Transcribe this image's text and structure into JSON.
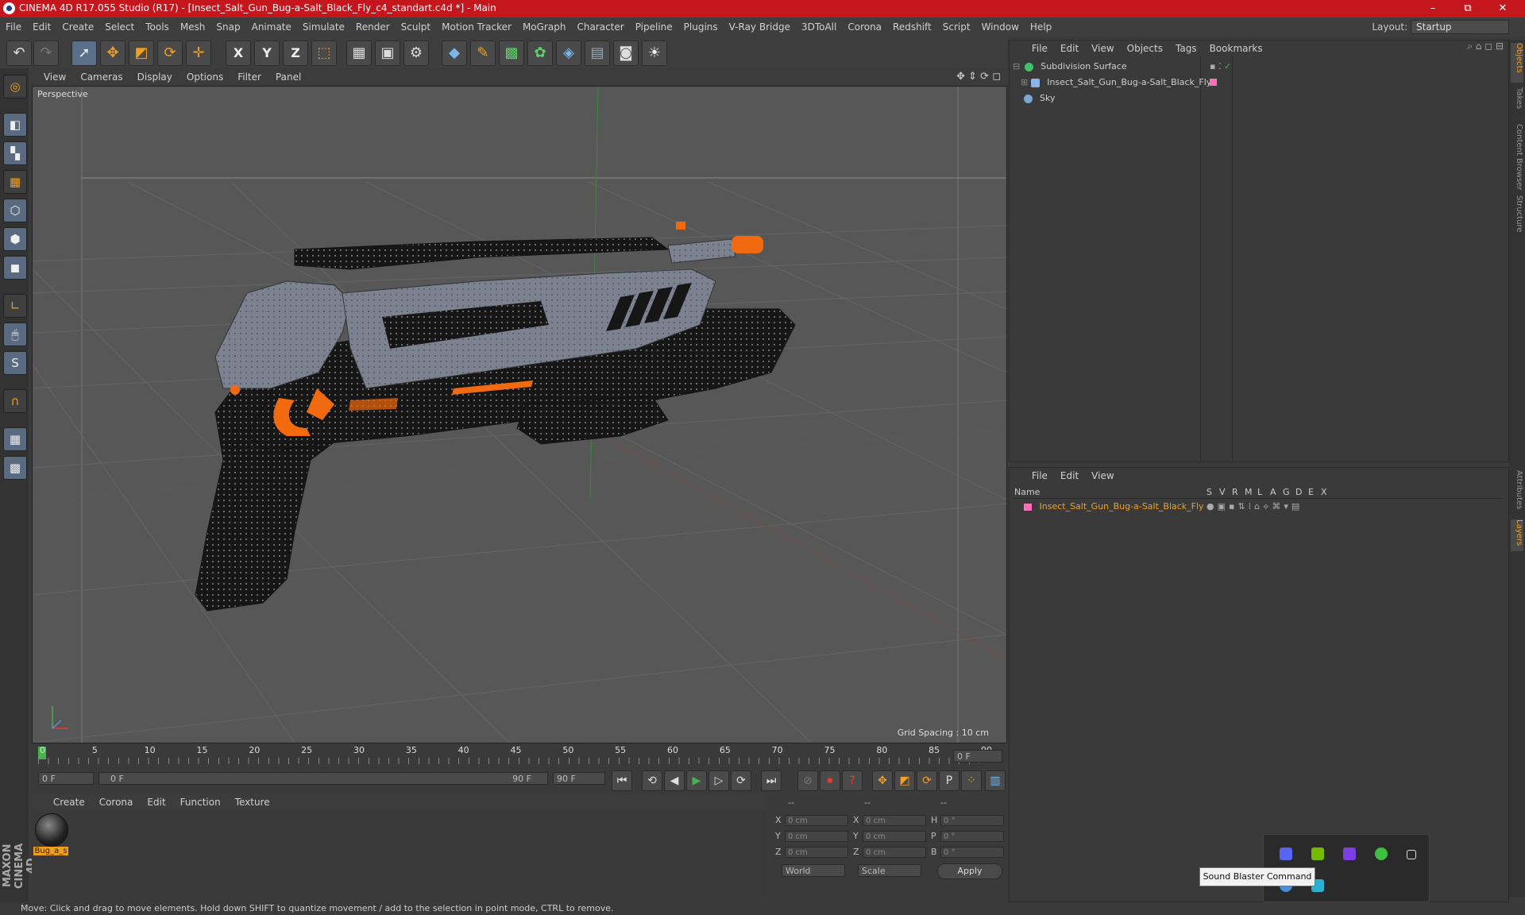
{
  "window": {
    "title": "CINEMA 4D R17.055 Studio (R17) - [Insect_Salt_Gun_Bug-a-Salt_Black_Fly_c4_standart.c4d *] - Main",
    "minimize": "–",
    "maximize": "⧉",
    "close": "✕"
  },
  "menubar": {
    "items": [
      "File",
      "Edit",
      "Create",
      "Select",
      "Tools",
      "Mesh",
      "Snap",
      "Animate",
      "Simulate",
      "Render",
      "Sculpt",
      "Motion Tracker",
      "MoGraph",
      "Character",
      "Pipeline",
      "Plugins",
      "V-Ray Bridge",
      "3DToAll",
      "Corona",
      "Redshift",
      "Script",
      "Window",
      "Help"
    ],
    "layout_label": "Layout:",
    "layout_value": "Startup"
  },
  "toolbar": {
    "x_label": "X",
    "y_label": "Y",
    "z_label": "Z"
  },
  "viewport": {
    "menu": [
      "View",
      "Cameras",
      "Display",
      "Options",
      "Filter",
      "Panel"
    ],
    "label": "Perspective",
    "grid_spacing": "Grid Spacing : 10 cm"
  },
  "timeline": {
    "ticks": [
      "0",
      "5",
      "10",
      "15",
      "20",
      "25",
      "30",
      "35",
      "40",
      "45",
      "50",
      "55",
      "60",
      "65",
      "70",
      "75",
      "80",
      "85",
      "90"
    ],
    "current_frame": "0 F",
    "start_field": "0 F",
    "range_start": "0 F",
    "range_end": "90 F",
    "end_field": "90 F"
  },
  "material_manager": {
    "menu": [
      "Create",
      "Corona",
      "Edit",
      "Function",
      "Texture"
    ],
    "material_name": "Bug_a_s"
  },
  "coordinates": {
    "header": [
      "--",
      "--",
      "--"
    ],
    "rows": [
      {
        "a": "X",
        "av": "0 cm",
        "b": "X",
        "bv": "0 cm",
        "c": "H",
        "cv": "0 °"
      },
      {
        "a": "Y",
        "av": "0 cm",
        "b": "Y",
        "bv": "0 cm",
        "c": "P",
        "cv": "0 °"
      },
      {
        "a": "Z",
        "av": "0 cm",
        "b": "Z",
        "bv": "0 cm",
        "c": "B",
        "cv": "0 °"
      }
    ],
    "world": "World",
    "scale": "Scale",
    "apply": "Apply"
  },
  "object_manager": {
    "menu": [
      "File",
      "Edit",
      "View",
      "Objects",
      "Tags",
      "Bookmarks"
    ],
    "objects": [
      {
        "name": "Subdivision Surface",
        "color": "#3fbf6a"
      },
      {
        "name": "Insect_Salt_Gun_Bug-a-Salt_Black_Fly",
        "color": "#8ab4e8"
      },
      {
        "name": "Sky",
        "color": "#7aa6d6"
      }
    ]
  },
  "layer_manager": {
    "menu": [
      "File",
      "Edit",
      "View"
    ],
    "columns": [
      "Name",
      "S",
      "V",
      "R",
      "M",
      "L",
      "A",
      "G",
      "D",
      "E",
      "X"
    ],
    "layer_name": "Insect_Salt_Gun_Bug-a-Salt_Black_Fly",
    "layer_color": "#f0a020"
  },
  "side_tabs": [
    "Objects",
    "Takes",
    "Content Browser",
    "Structure",
    "Attributes",
    "Layers"
  ],
  "status_bar": "Move: Click and drag to move elements. Hold down SHIFT to quantize movement / add to the selection in point mode, CTRL to remove.",
  "tray": {
    "tooltip": "Sound Blaster Command"
  },
  "maxon_logo": "MAXON CINEMA 4D"
}
